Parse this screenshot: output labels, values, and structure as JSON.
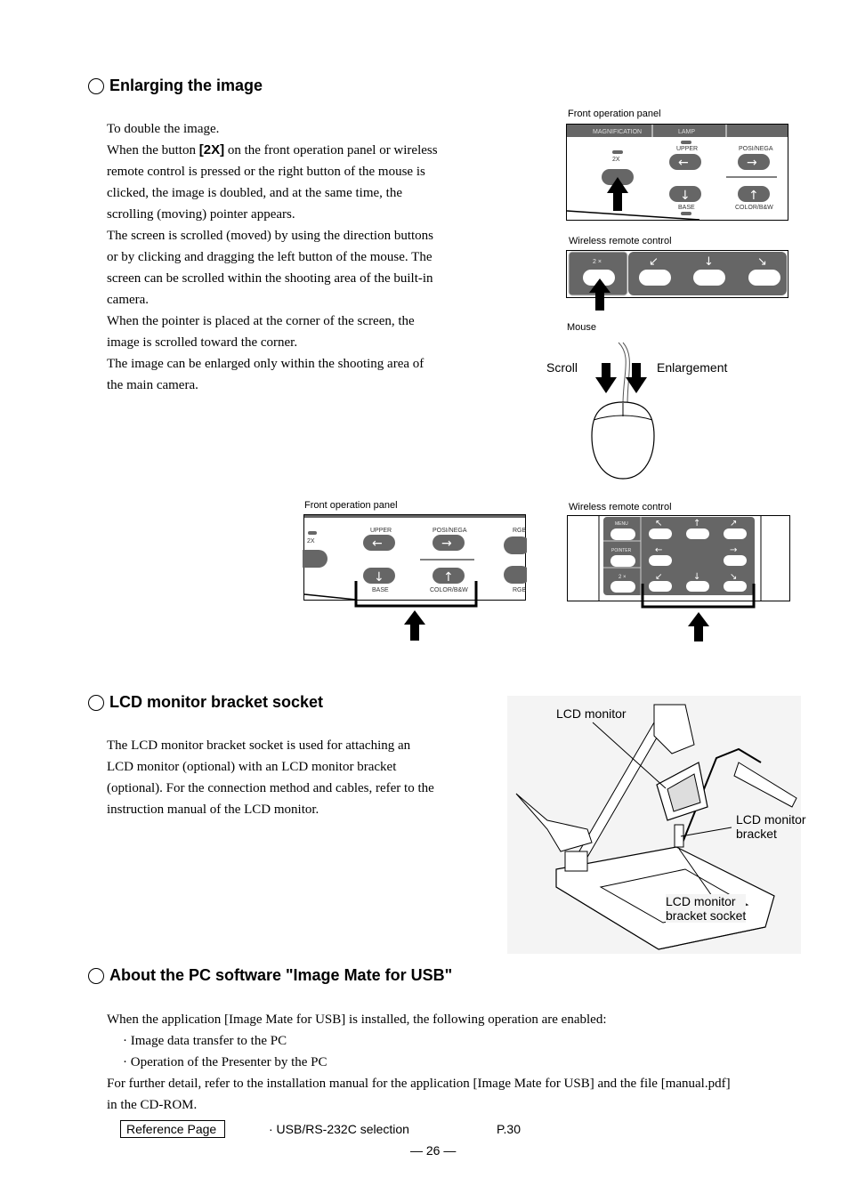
{
  "sections": {
    "enlarge": {
      "title": "Enlarging the image",
      "lines": [
        "To double the image.",
        "When the button ",
        "[2X]",
        " on the front operation panel or wireless",
        "remote control is pressed or the right button of the mouse is",
        "clicked, the image is doubled, and at the same time, the",
        "scrolling (moving) pointer appears.",
        "The screen is scrolled (moved) by using the direction buttons",
        "or by clicking and dragging the left button of the mouse.  The",
        "screen can be scrolled within the shooting area of the built-in",
        "camera.",
        "When the pointer is placed at the corner of the screen, the",
        "image is scrolled toward the corner.",
        "The image can be enlarged only within the shooting area of",
        "the main camera."
      ],
      "fig": {
        "front_panel_caption": "Front operation panel",
        "remote_caption": "Wireless remote control",
        "mouse_caption": "Mouse",
        "scroll_label": "Scroll",
        "enlargement_label": "Enlargement",
        "panel_labels": {
          "magnification": "MAGNIFICATION",
          "lamp": "LAMP",
          "x2": "2X",
          "upper": "UPPER",
          "posi_nega": "POSI/NEGA",
          "base": "BASE",
          "color_bw": "COLOR/B&W",
          "rgb": "RGB"
        },
        "remote_labels": {
          "x2": "2 ×",
          "menu": "MENU",
          "pointer": "POINTER"
        },
        "bottom_front_caption": "Front operation panel",
        "bottom_remote_caption": "Wireless remote control"
      }
    },
    "lcd": {
      "title": "LCD monitor bracket socket",
      "lines": [
        "The LCD monitor bracket socket is used for attaching an",
        "LCD monitor (optional) with an LCD monitor bracket",
        "(optional).  For the connection method and cables, refer to the",
        "instruction manual of the LCD monitor."
      ],
      "fig": {
        "lcd_monitor": "LCD monitor",
        "bracket": [
          "LCD monitor",
          "bracket"
        ],
        "socket": [
          "LCD monitor",
          "bracket socket"
        ]
      }
    },
    "software": {
      "title": "About the PC software \"Image Mate for USB\"",
      "lines": [
        "When the application [Image Mate for USB] is installed, the following operation are enabled:",
        "·  Image data transfer to the PC",
        "·  Operation of the Presenter by the PC",
        "For further detail, refer to the installation manual for the application [Image Mate for USB] and the file [manual.pdf]",
        "in the CD-ROM."
      ]
    }
  },
  "reference": {
    "label": "Reference Page",
    "item": "· USB/RS-232C selection",
    "page": "P.30"
  },
  "page_number": "— 26 —",
  "colors": {
    "panel_gray": "#666666"
  }
}
